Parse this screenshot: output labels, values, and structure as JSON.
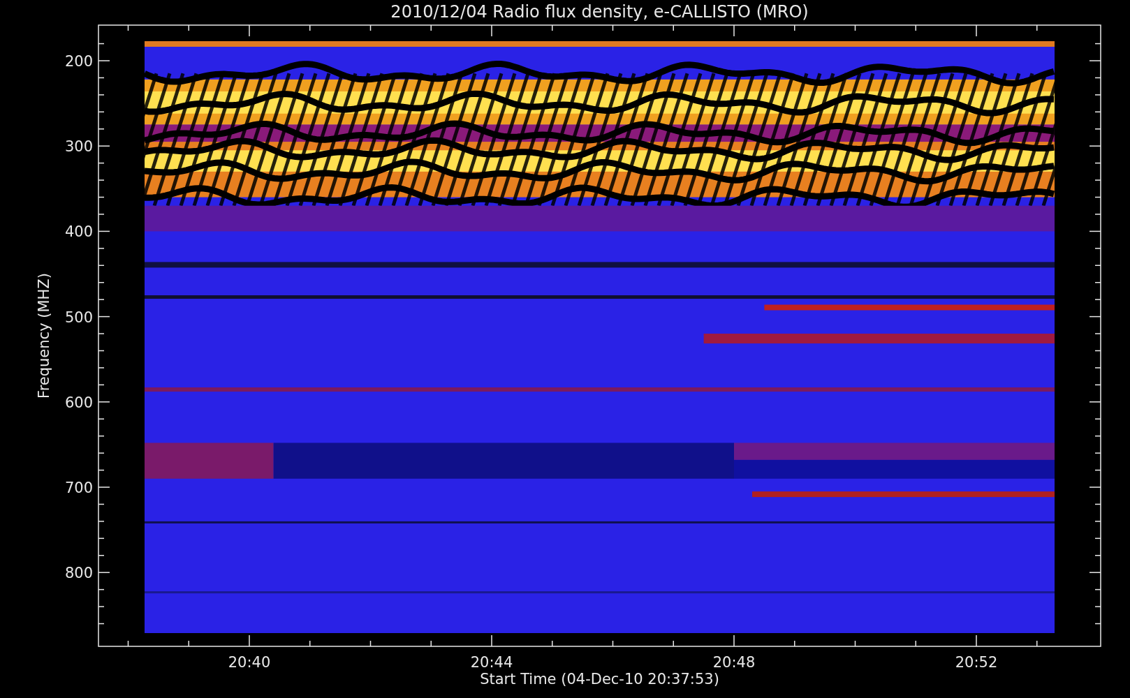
{
  "chart": {
    "title": "2010/12/04  Radio flux density, e-CALLISTO (MRO)",
    "y_axis": {
      "label": "Frequency (MHZ)",
      "ticks": [
        "200",
        "300",
        "400",
        "500",
        "600",
        "700",
        "800"
      ]
    },
    "x_axis": {
      "label": "Start Time (04-Dec-10 20:37:53)",
      "ticks": [
        "20:40",
        "20:44",
        "20:48",
        "20:52"
      ]
    }
  }
}
